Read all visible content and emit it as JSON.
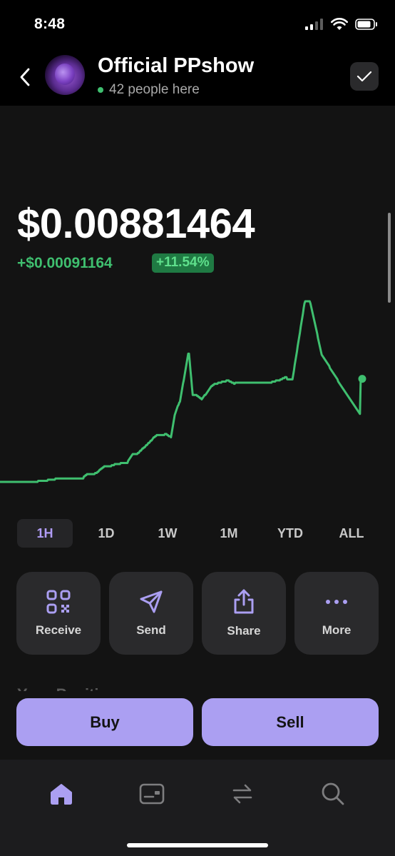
{
  "status_bar": {
    "time": "8:48"
  },
  "header": {
    "title": "Official PPshow",
    "presence": "42 people here"
  },
  "price": {
    "value": "$0.00881464",
    "change": "+$0.00091164",
    "change_pct": "+11.54%"
  },
  "chart_data": {
    "type": "line",
    "title": "",
    "xlabel": "",
    "ylabel": "",
    "line_color": "#3fbf6f",
    "x": [
      0,
      1,
      2,
      3,
      4,
      5,
      6,
      7,
      8,
      9,
      10,
      11,
      12,
      13,
      14,
      15,
      16,
      17,
      18,
      19,
      20,
      21,
      22,
      23,
      24,
      25,
      26,
      27,
      28,
      29,
      30,
      31,
      32,
      33,
      34,
      35,
      36,
      37,
      38,
      39,
      40,
      41,
      42,
      43,
      44,
      45,
      46,
      47,
      48,
      49,
      50,
      51,
      52,
      53,
      54,
      55,
      56,
      57,
      58,
      59,
      60,
      61,
      62,
      63,
      64,
      65,
      66,
      67,
      68,
      69,
      70,
      71,
      72,
      73,
      74,
      75,
      76,
      77,
      78,
      79,
      80,
      81,
      82,
      83,
      84,
      85,
      86,
      87,
      88,
      89,
      90,
      91,
      92,
      93,
      94,
      95,
      96,
      97,
      98,
      99,
      100,
      101,
      102,
      103,
      104,
      105,
      106,
      107,
      108,
      109,
      110,
      111,
      112,
      113,
      114,
      115,
      116,
      117,
      118,
      119,
      120,
      121,
      122,
      123,
      124,
      125,
      126,
      127,
      128,
      129,
      130,
      131,
      132,
      133,
      134,
      135,
      136,
      137,
      138,
      139,
      140,
      141,
      142,
      143,
      144,
      145,
      146,
      147,
      148,
      149,
      150,
      151,
      152,
      153,
      154,
      155,
      156,
      157,
      158,
      159,
      160,
      161,
      162,
      163,
      164,
      165,
      166,
      167,
      168,
      169,
      170,
      171,
      172,
      173,
      174,
      175,
      176,
      177,
      178,
      179,
      180,
      181,
      182,
      183,
      184,
      185,
      186,
      187,
      188,
      189,
      190,
      191,
      192,
      193,
      194,
      195,
      196,
      197,
      198,
      199,
      200,
      201,
      202,
      203,
      204,
      205,
      206,
      207,
      208,
      209,
      210,
      211,
      212,
      213,
      214,
      215,
      216,
      217,
      218,
      219,
      220,
      221,
      222,
      223,
      224,
      225,
      226,
      227,
      228,
      229,
      230,
      231,
      232,
      233,
      234,
      235,
      236,
      237,
      238,
      239,
      240,
      241,
      242,
      243,
      244,
      245,
      246,
      247,
      248,
      249,
      250,
      251,
      252,
      253,
      254,
      255,
      256,
      257,
      258,
      259,
      260,
      261,
      262,
      263,
      264,
      265,
      266,
      267,
      268,
      269,
      270,
      271,
      272,
      273,
      274,
      275,
      276,
      277,
      278,
      279,
      280,
      281,
      282,
      283,
      284,
      285,
      286,
      287,
      288,
      289,
      290,
      291,
      292,
      293,
      294,
      295,
      296,
      297,
      298,
      299,
      300,
      301,
      302,
      303,
      304,
      305,
      306,
      307,
      308,
      309,
      310,
      311,
      312,
      313,
      314,
      315,
      316,
      317,
      318,
      319,
      320,
      321,
      322,
      323,
      324,
      325,
      326,
      327,
      328,
      329,
      330,
      331,
      332,
      333,
      334,
      335,
      336,
      337,
      338,
      339,
      340,
      341,
      342,
      343,
      344,
      345,
      346,
      347,
      348,
      349,
      350,
      351,
      352,
      353,
      354,
      355,
      356,
      357,
      358,
      359,
      360,
      361,
      362,
      363,
      364,
      365,
      366,
      367,
      368,
      369,
      370,
      371,
      372,
      373,
      374,
      375,
      376,
      377,
      378,
      379,
      380,
      381,
      382,
      383,
      384,
      385,
      386,
      387,
      388,
      389,
      390,
      391,
      392,
      393,
      394,
      395,
      396,
      397,
      398,
      399,
      400,
      401,
      402,
      403,
      404,
      405,
      406,
      407,
      408,
      409,
      410,
      411,
      412,
      413,
      414,
      415,
      416,
      417,
      418,
      419,
      420,
      421,
      422,
      423,
      424,
      425,
      426,
      427,
      428,
      429,
      430,
      431,
      432,
      433,
      434,
      435,
      436,
      437,
      438,
      439,
      440,
      441,
      442,
      443,
      444,
      445,
      446,
      447,
      448,
      449,
      450,
      451,
      452,
      453,
      454,
      455,
      456,
      457,
      458,
      459,
      460,
      461,
      462,
      463,
      464,
      465,
      466,
      467,
      468,
      469,
      470,
      471,
      472,
      473,
      474,
      475,
      476,
      477,
      478,
      479,
      480,
      481,
      482,
      483,
      484,
      485,
      486,
      487,
      488,
      489,
      490,
      491,
      492,
      493,
      494,
      495,
      496,
      497,
      498,
      499,
      500,
      501,
      502,
      503,
      504,
      505,
      506,
      507,
      508
    ],
    "values": [
      0.00789,
      0.00789,
      0.00789,
      0.00789,
      0.00789,
      0.00789,
      0.00789,
      0.00789,
      0.00789,
      0.00789,
      0.00789,
      0.00789,
      0.00789,
      0.00789,
      0.00789,
      0.00789,
      0.00789,
      0.00789,
      0.00789,
      0.00789,
      0.00789,
      0.00789,
      0.00789,
      0.00789,
      0.00789,
      0.00789,
      0.00789,
      0.00789,
      0.00789,
      0.00789,
      0.00789,
      0.00789,
      0.00789,
      0.00789,
      0.00789,
      0.00789,
      0.00789,
      0.00789,
      0.00789,
      0.00789,
      0.00789,
      0.00789,
      0.00789,
      0.00789,
      0.00789,
      0.00789,
      0.00789,
      0.00789,
      0.00789,
      0.00789,
      0.00789,
      0.0079,
      0.0079,
      0.0079,
      0.0079,
      0.0079,
      0.0079,
      0.0079,
      0.0079,
      0.0079,
      0.0079,
      0.0079,
      0.0079,
      0.0079,
      0.00791,
      0.00791,
      0.00791,
      0.00791,
      0.00791,
      0.00791,
      0.00791,
      0.00791,
      0.00791,
      0.00791,
      0.00792,
      0.00792,
      0.00792,
      0.00792,
      0.00792,
      0.00792,
      0.00792,
      0.00792,
      0.00792,
      0.00792,
      0.00792,
      0.00792,
      0.00792,
      0.00792,
      0.00792,
      0.00792,
      0.00792,
      0.00792,
      0.00792,
      0.00792,
      0.00792,
      0.00792,
      0.00792,
      0.00792,
      0.00792,
      0.00792,
      0.00792,
      0.00792,
      0.00792,
      0.00792,
      0.00792,
      0.00792,
      0.00792,
      0.00792,
      0.00792,
      0.00792,
      0.00792,
      0.00792,
      0.00794,
      0.00794,
      0.00795,
      0.00795,
      0.00796,
      0.00796,
      0.00796,
      0.00796,
      0.00796,
      0.00796,
      0.00796,
      0.00796,
      0.00796,
      0.00796,
      0.00796,
      0.00797,
      0.00797,
      0.00797,
      0.00798,
      0.00798,
      0.00799,
      0.008,
      0.008,
      0.00801,
      0.00801,
      0.00802,
      0.00802,
      0.00803,
      0.00803,
      0.00803,
      0.00803,
      0.00803,
      0.00803,
      0.00803,
      0.00803,
      0.00803,
      0.00803,
      0.00804,
      0.00804,
      0.00804,
      0.00804,
      0.00805,
      0.00805,
      0.00805,
      0.00805,
      0.00805,
      0.00805,
      0.00805,
      0.00805,
      0.00806,
      0.00806,
      0.00806,
      0.00806,
      0.00806,
      0.00806,
      0.00806,
      0.00806,
      0.00806,
      0.00806,
      0.00808,
      0.00809,
      0.0081,
      0.00811,
      0.00812,
      0.00813,
      0.00814,
      0.00814,
      0.00814,
      0.00814,
      0.00814,
      0.00814,
      0.00814,
      0.00815,
      0.00815,
      0.00816,
      0.00817,
      0.00817,
      0.00818,
      0.00819,
      0.00819,
      0.0082,
      0.0082,
      0.00821,
      0.00822,
      0.00822,
      0.00823,
      0.00824,
      0.00824,
      0.00825,
      0.00826,
      0.00826,
      0.00827,
      0.00828,
      0.00829,
      0.00829,
      0.0083,
      0.0083,
      0.00831,
      0.00831,
      0.00831,
      0.00831,
      0.00831,
      0.00831,
      0.00831,
      0.00831,
      0.00831,
      0.00831,
      0.00831,
      0.00832,
      0.00832,
      0.00832,
      0.00831,
      0.00831,
      0.0083,
      0.0083,
      0.0083,
      0.00829,
      0.00833,
      0.00837,
      0.00841,
      0.00845,
      0.00849,
      0.00851,
      0.00853,
      0.00855,
      0.00857,
      0.00858,
      0.0086,
      0.00861,
      0.00865,
      0.00869,
      0.00873,
      0.00877,
      0.0088,
      0.00884,
      0.00888,
      0.00892,
      0.00896,
      0.009,
      0.00904,
      0.00904,
      0.00897,
      0.00889,
      0.00882,
      0.00874,
      0.00867,
      0.00867,
      0.00867,
      0.00867,
      0.00867,
      0.00867,
      0.00866,
      0.00866,
      0.00865,
      0.00865,
      0.00864,
      0.00864,
      0.00863,
      0.00864,
      0.00865,
      0.00866,
      0.00867,
      0.00867,
      0.00868,
      0.00869,
      0.0087,
      0.00871,
      0.00872,
      0.00873,
      0.00874,
      0.00875,
      0.00875,
      0.00876,
      0.00876,
      0.00877,
      0.00877,
      0.00877,
      0.00877,
      0.00877,
      0.00878,
      0.00878,
      0.00878,
      0.00878,
      0.00878,
      0.00879,
      0.00879,
      0.00879,
      0.00879,
      0.00879,
      0.00879,
      0.0088,
      0.0088,
      0.0088,
      0.0088,
      0.00879,
      0.00879,
      0.00879,
      0.00878,
      0.00878,
      0.00878,
      0.00877,
      0.00877,
      0.00878,
      0.00878,
      0.00878,
      0.00878,
      0.00878,
      0.00878,
      0.00878,
      0.00878,
      0.00878,
      0.00878,
      0.00878,
      0.00878,
      0.00878,
      0.00878,
      0.00878,
      0.00878,
      0.00878,
      0.00878,
      0.00878,
      0.00878,
      0.00878,
      0.00878,
      0.00878,
      0.00878,
      0.00878,
      0.00878,
      0.00878,
      0.00878,
      0.00878,
      0.00878,
      0.00878,
      0.00878,
      0.00878,
      0.00878,
      0.00878,
      0.00878,
      0.00878,
      0.00878,
      0.00878,
      0.00878,
      0.00878,
      0.00878,
      0.00878,
      0.00878,
      0.00878,
      0.00878,
      0.00878,
      0.00878,
      0.00878,
      0.00879,
      0.00879,
      0.00879,
      0.00879,
      0.00879,
      0.0088,
      0.0088,
      0.0088,
      0.0088,
      0.0088,
      0.0088,
      0.00881,
      0.00881,
      0.00881,
      0.00882,
      0.00882,
      0.00882,
      0.00883,
      0.00883,
      0.00883,
      0.00881,
      0.00881,
      0.00881,
      0.00881,
      0.00881,
      0.00881,
      0.00881,
      0.00881,
      0.00885,
      0.00889,
      0.00894,
      0.00898,
      0.00902,
      0.00906,
      0.00911,
      0.00915,
      0.00919,
      0.00923,
      0.00928,
      0.00932,
      0.00936,
      0.0094,
      0.00945,
      0.00949,
      0.00951,
      0.00951,
      0.00951,
      0.00951,
      0.00951,
      0.00951,
      0.00951,
      0.00949,
      0.00946,
      0.00943,
      0.0094,
      0.00937,
      0.00934,
      0.00931,
      0.00928,
      0.00925,
      0.00922,
      0.00918,
      0.00915,
      0.00912,
      0.00909,
      0.00906,
      0.00903,
      0.00902,
      0.00901,
      0.009,
      0.00899,
      0.00898,
      0.00897,
      0.00896,
      0.00895,
      0.00894,
      0.00893,
      0.00891,
      0.0089,
      0.00889,
      0.00888,
      0.00887,
      0.00886,
      0.00885,
      0.00884,
      0.00883,
      0.00882,
      0.00881,
      0.00879,
      0.00878,
      0.00877,
      0.00876,
      0.00875,
      0.00874,
      0.00873,
      0.00872,
      0.00871,
      0.0087,
      0.00869,
      0.00868,
      0.00867,
      0.00866,
      0.00865,
      0.00864,
      0.00863,
      0.00862,
      0.00861,
      0.0086,
      0.00859,
      0.00858,
      0.00857,
      0.00856,
      0.00855,
      0.00854,
      0.00853,
      0.00852,
      0.00851,
      0.0085,
      0.00881,
      0.00881,
      0.00881
    ],
    "last_point": 0.00881464
  },
  "ranges": [
    "1H",
    "1D",
    "1W",
    "1M",
    "YTD",
    "ALL"
  ],
  "active_range": "1H",
  "actions": [
    {
      "label": "Receive",
      "icon": "qr-code-icon"
    },
    {
      "label": "Send",
      "icon": "send-icon"
    },
    {
      "label": "Share",
      "icon": "share-icon"
    },
    {
      "label": "More",
      "icon": "more-icon"
    }
  ],
  "position_section": {
    "title": "Your Position"
  },
  "trade": {
    "buy": "Buy",
    "sell": "Sell"
  },
  "colors": {
    "accent": "#ab9ff2",
    "positive": "#3fbf6f",
    "background": "#131313"
  },
  "tabs": [
    {
      "name": "home",
      "icon": "home-icon",
      "active": true
    },
    {
      "name": "collectibles",
      "icon": "card-icon",
      "active": false
    },
    {
      "name": "swap",
      "icon": "swap-icon",
      "active": false
    },
    {
      "name": "search",
      "icon": "search-icon",
      "active": false
    }
  ]
}
